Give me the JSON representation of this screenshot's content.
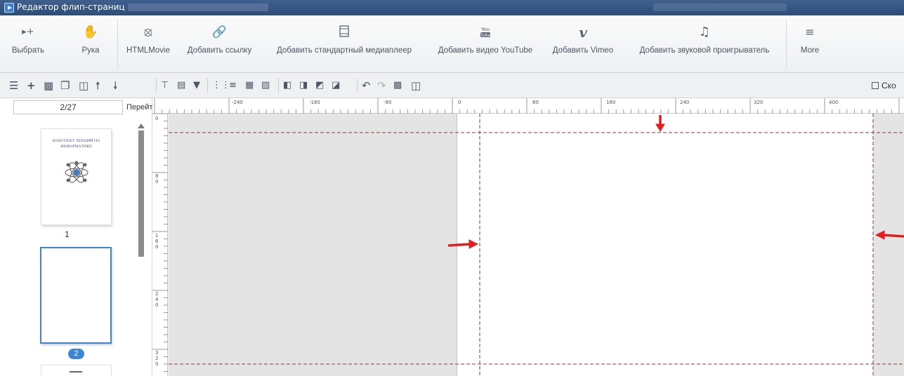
{
  "window": {
    "title": "Редактор флип-страниц"
  },
  "ribbon": {
    "buttons": [
      {
        "key": "select",
        "label": "Выбрать",
        "icon": "select-arrow-icon"
      },
      {
        "key": "hand",
        "label": "Рука",
        "icon": "hand-icon"
      },
      {
        "key": "htmlmovie",
        "label": "HTMLMovie",
        "icon": "film-reel-icon"
      },
      {
        "key": "link",
        "label": "Добавить ссылку",
        "icon": "link-icon"
      },
      {
        "key": "mediaplayer",
        "label": "Добавить стандартный медиаплеер",
        "icon": "film-strip-icon"
      },
      {
        "key": "youtube",
        "label": "Добавить видео YouTube",
        "icon": "youtube-icon"
      },
      {
        "key": "vimeo",
        "label": "Добавить Vimeo",
        "icon": "vimeo-icon"
      },
      {
        "key": "audio",
        "label": "Добавить звуковой проигрыватель",
        "icon": "music-note-icon"
      },
      {
        "key": "more",
        "label": "More",
        "icon": "more-list-icon"
      }
    ]
  },
  "toolbar": {
    "cut_label": "Ско"
  },
  "pages_panel": {
    "page_indicator": "2/27",
    "go_label": "Перейти",
    "thumb1_title_line1": "КОНСПЕКТ ЛЕКЦИЙ ПО",
    "thumb1_title_line2": "ИНФОРМАТИКЕ",
    "thumb1_number": "1",
    "thumb2_number": "2"
  },
  "ruler": {
    "h_labels": [
      "-240",
      "-160",
      "-80",
      "0",
      "80",
      "160",
      "240",
      "320",
      "400"
    ],
    "v_labels": [
      "0",
      "8\n0",
      "1\n6\n0",
      "2\n4\n0",
      "3\n2\n0"
    ]
  },
  "colors": {
    "accent": "#3b86d6",
    "guide": "#8b2a2a",
    "arrow": "#e02020"
  }
}
